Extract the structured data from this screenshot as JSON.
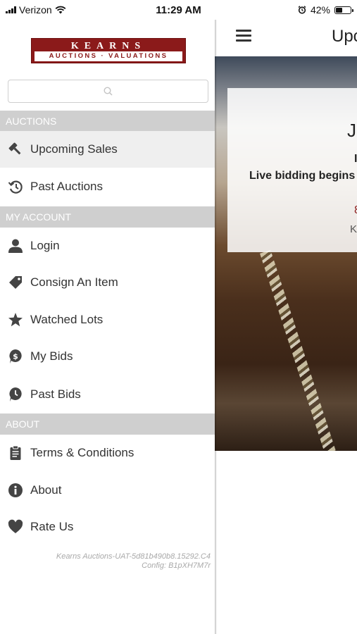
{
  "status_bar": {
    "carrier": "Verizon",
    "time": "11:29 AM",
    "battery_percent": "42%"
  },
  "logo": {
    "line1": "KEARNS",
    "line2": "AUCTIONS · VALUATIONS"
  },
  "search": {
    "placeholder": ""
  },
  "menu": {
    "sections": [
      {
        "title": "AUCTIONS",
        "items": [
          {
            "label": "Upcoming Sales",
            "icon": "gavel-icon",
            "active": true
          },
          {
            "label": "Past Auctions",
            "icon": "history-icon",
            "active": false
          }
        ]
      },
      {
        "title": "MY ACCOUNT",
        "items": [
          {
            "label": "Login",
            "icon": "user-icon"
          },
          {
            "label": "Consign An Item",
            "icon": "tag-icon"
          },
          {
            "label": "Watched Lots",
            "icon": "star-icon"
          },
          {
            "label": "My Bids",
            "icon": "dollar-icon"
          },
          {
            "label": "Past Bids",
            "icon": "clock-pin-icon"
          }
        ]
      },
      {
        "title": "ABOUT",
        "items": [
          {
            "label": "Terms & Conditions",
            "icon": "clipboard-icon"
          },
          {
            "label": "About",
            "icon": "info-icon"
          },
          {
            "label": "Rate Us",
            "icon": "heart-icon"
          }
        ]
      }
    ]
  },
  "version": {
    "line1": "Kearns Auctions-UAT-5d81b490b8.15292.C4",
    "line2": "Config: B1pXH7M7r"
  },
  "background": {
    "page_title": "Upc",
    "card": {
      "line1": "J",
      "line2": "I",
      "line3": "Live bidding begins",
      "line4": "8",
      "line5": "K"
    }
  },
  "colors": {
    "brand": "#8b1a1a",
    "section_header": "#cfcfcf",
    "active_item": "#efefef",
    "icon": "#444444"
  }
}
